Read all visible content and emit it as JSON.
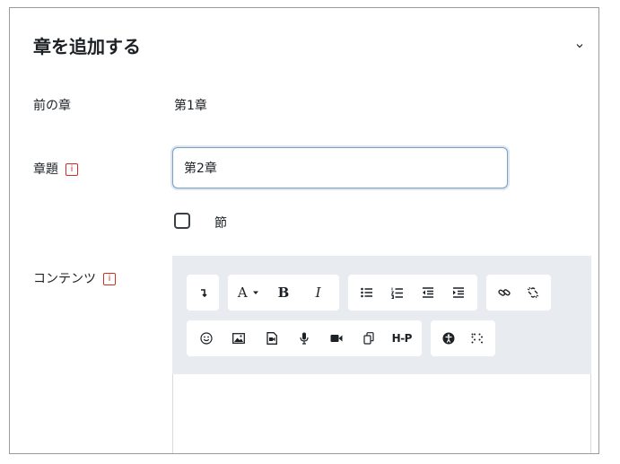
{
  "section": {
    "title": "章を追加する"
  },
  "form": {
    "prev_chapter_label": "前の章",
    "prev_chapter_value": "第1章",
    "chapter_title_label": "章題",
    "chapter_title_value": "第2章",
    "subchapter_label": "節",
    "content_label": "コンテンツ",
    "required_icon": "i"
  },
  "toolbar": {
    "font_label": "A",
    "bold_label": "B",
    "italic_label": "I",
    "h5p_label": "H-P",
    "icons": [
      "collapse-icon",
      "font-dropdown-icon",
      "bold-icon",
      "italic-icon",
      "unordered-list-icon",
      "ordered-list-icon",
      "outdent-icon",
      "indent-icon",
      "link-icon",
      "unlink-icon",
      "emoji-icon",
      "image-icon",
      "media-icon",
      "record-audio-icon",
      "record-video-icon",
      "manage-files-icon",
      "h5p-icon",
      "accessibility-checker-icon",
      "screenreader-helper-icon"
    ]
  },
  "colors": {
    "required": "#ca3120",
    "focus_border": "#7e9fc6",
    "toolbar_bg": "#e8ecf1"
  }
}
